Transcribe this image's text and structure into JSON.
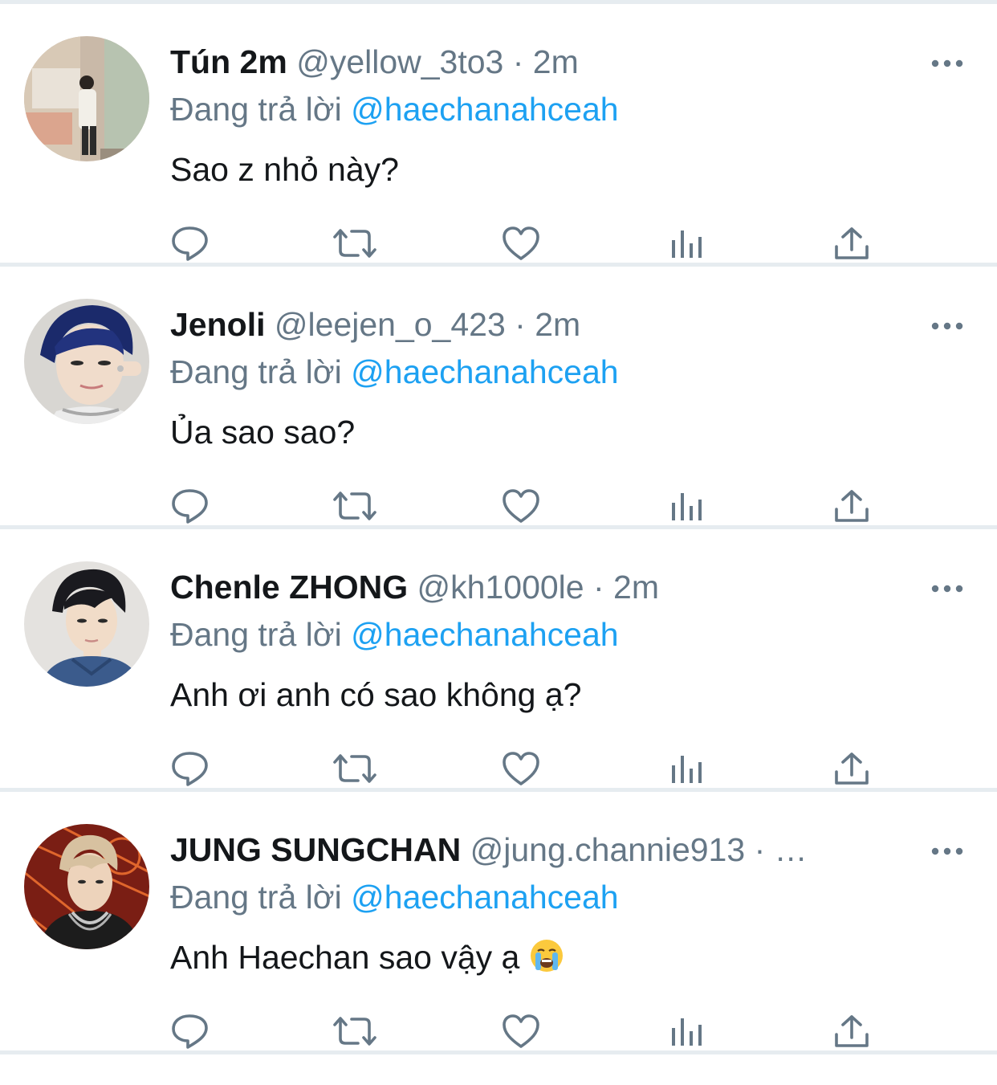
{
  "feed": {
    "tweets": [
      {
        "display_name": "Tún 2m",
        "handle": "@yellow_3to3",
        "separator": " · ",
        "time": "2m",
        "reply_prefix": "Đang trả lời ",
        "reply_to": "@haechanahceah",
        "text": "Sao z nhỏ này?",
        "avatar_colors": {
          "bg": "#c9b9a8",
          "accent": "#e9e2d8",
          "figure": "#f2efe8"
        }
      },
      {
        "display_name": "Jenoli",
        "handle": "@leejen_o_423",
        "separator": " · ",
        "time": "2m",
        "reply_prefix": "Đang trả lời ",
        "reply_to": "@haechanahceah",
        "text": "Ủa sao sao?",
        "avatar_colors": {
          "bg": "#d8d6d2",
          "accent": "#1b2a6b",
          "figure": "#f0dccb"
        }
      },
      {
        "display_name": "Chenle ZHONG",
        "handle": "@kh1000le",
        "separator": " · ",
        "time": "2m",
        "reply_prefix": "Đang trả lời ",
        "reply_to": "@haechanahceah",
        "text": "Anh ơi anh có sao không ạ?",
        "avatar_colors": {
          "bg": "#e4e2df",
          "accent": "#1a1a1f",
          "figure": "#3b5b8c"
        }
      },
      {
        "display_name": "JUNG SUNGCHAN",
        "handle": "@jung.channie913",
        "separator": " · ",
        "time": "…",
        "reply_prefix": "Đang trả lời ",
        "reply_to": "@haechanahceah",
        "text": "Anh Haechan sao vậy ạ",
        "emoji": "crying-face",
        "avatar_colors": {
          "bg": "#7a1e14",
          "accent": "#e0662c",
          "figure": "#1c1c1c"
        }
      }
    ]
  },
  "colors": {
    "name": "#14171a",
    "secondary": "#657786",
    "link": "#1da1f2",
    "divider": "#e6ecf0",
    "icon": "#657786"
  },
  "actions": [
    "reply-icon",
    "retweet-icon",
    "like-icon",
    "analytics-icon",
    "share-icon"
  ]
}
